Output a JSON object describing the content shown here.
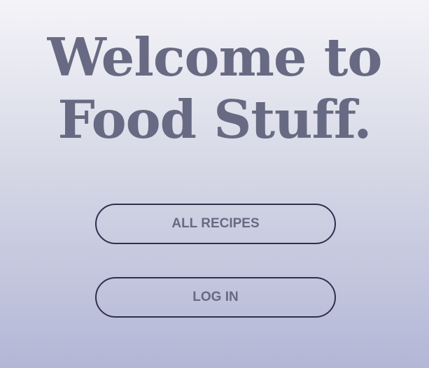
{
  "hero": {
    "title_line1": "Welcome to",
    "title_line2": "Food Stuff."
  },
  "actions": {
    "all_recipes_label": "ALL RECIPES",
    "login_label": "LOG IN"
  },
  "colors": {
    "text": "#676a82",
    "button_border": "#2f3050",
    "background_top": "#f4f4f8",
    "background_bottom": "#b3b7d6"
  }
}
